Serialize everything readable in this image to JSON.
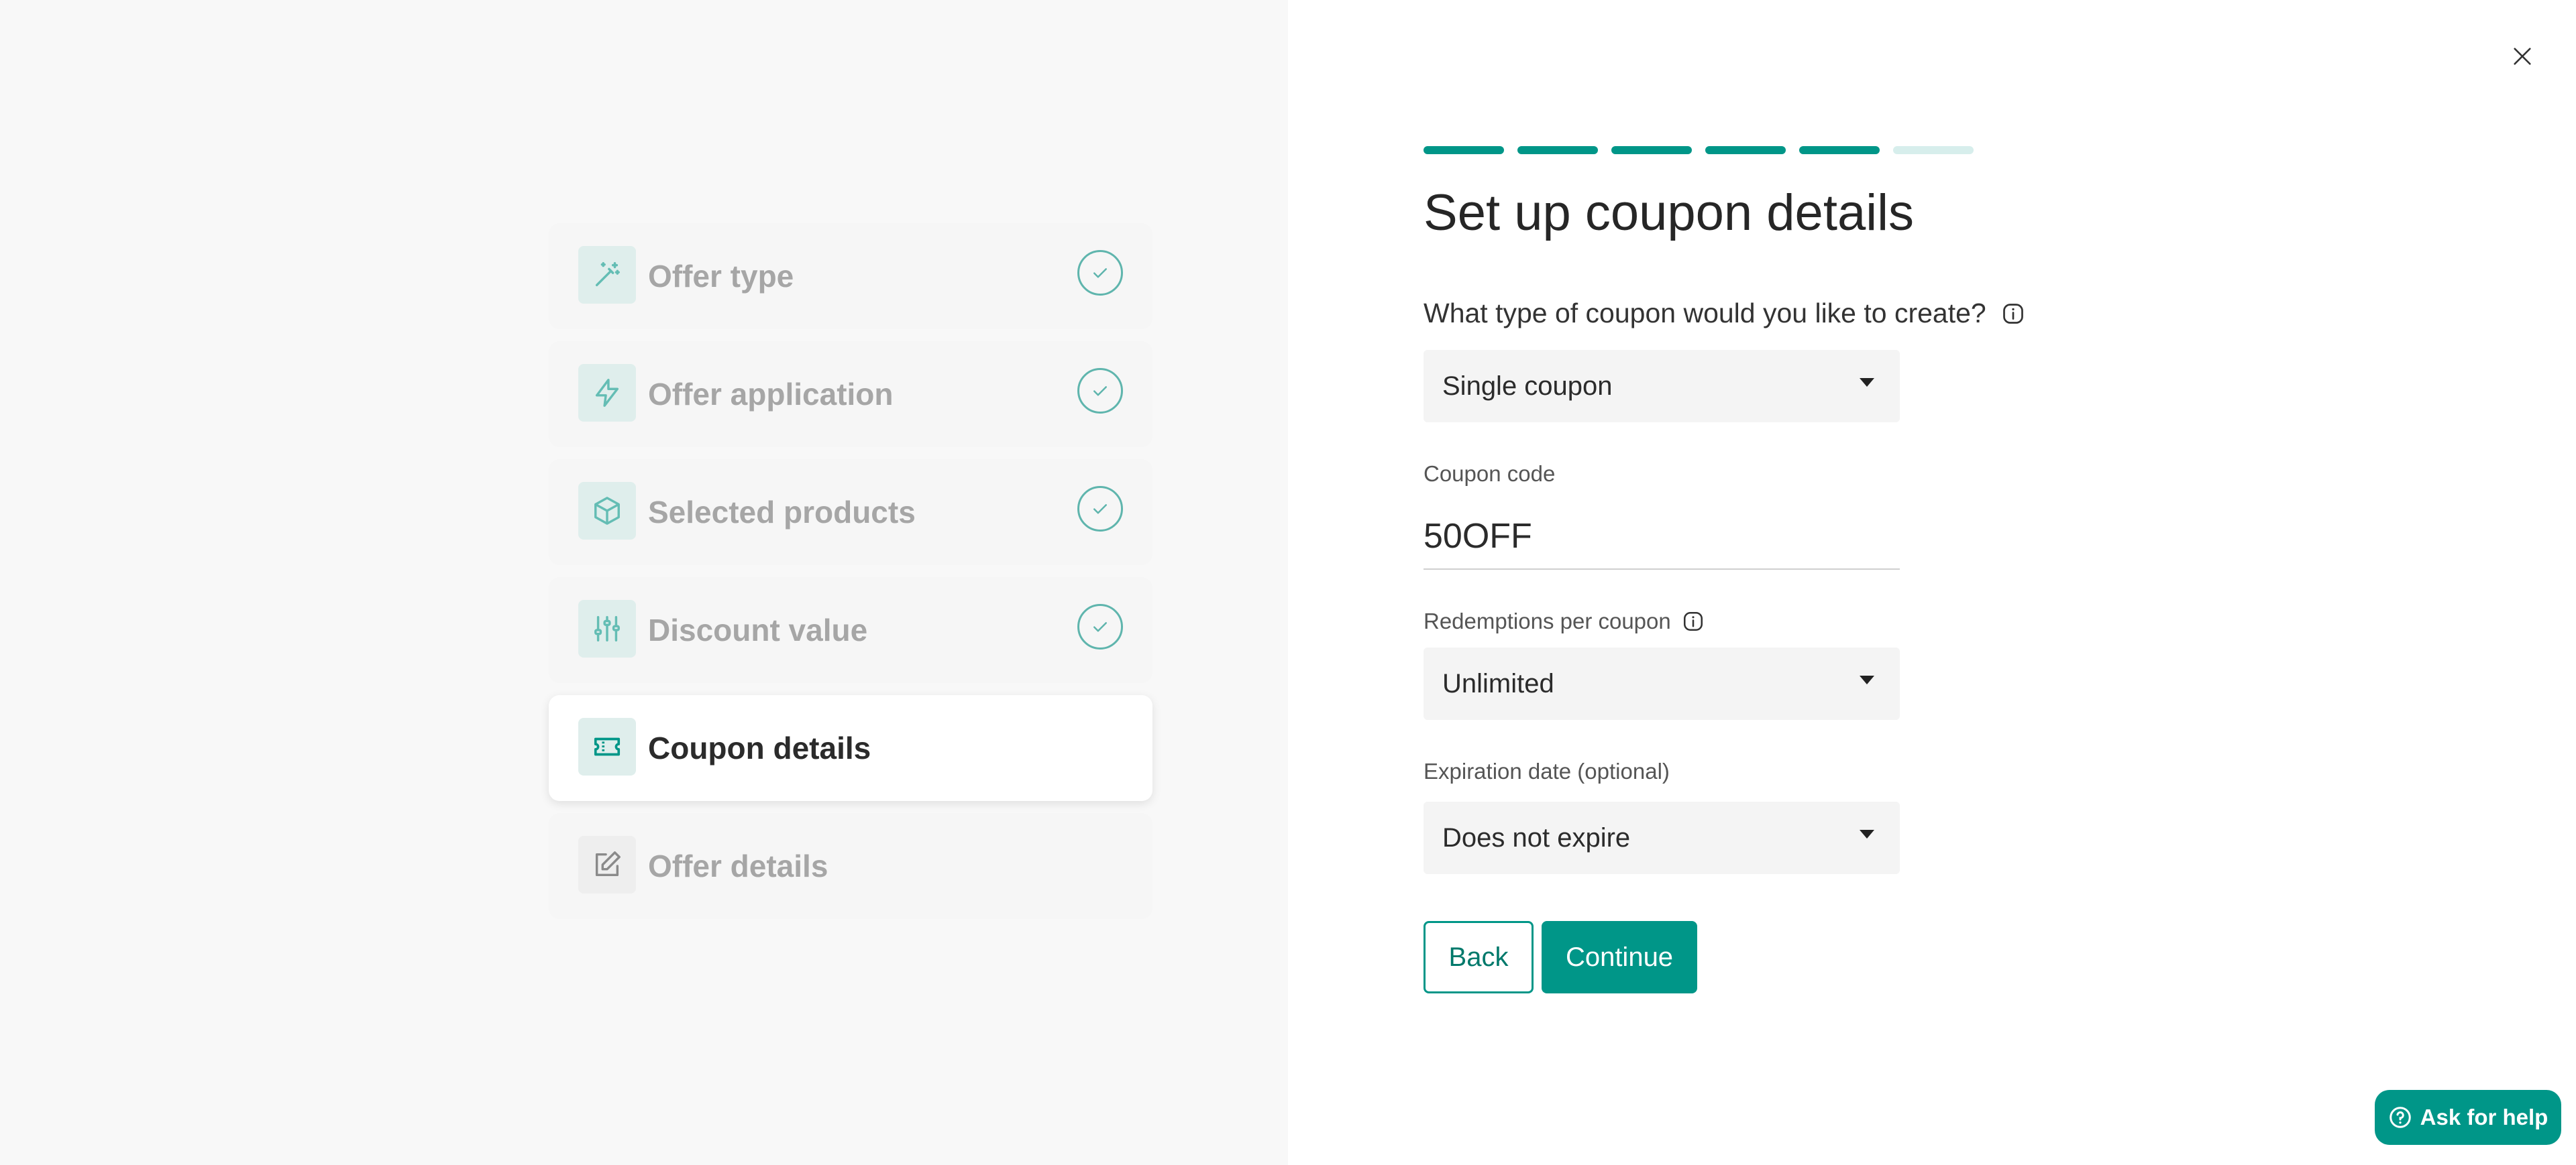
{
  "steps": [
    {
      "label": "Offer type",
      "icon": "magic-wand-icon",
      "state": "done"
    },
    {
      "label": "Offer application",
      "icon": "lightning-bolt-icon",
      "state": "done"
    },
    {
      "label": "Selected products",
      "icon": "box-icon",
      "state": "done"
    },
    {
      "label": "Discount value",
      "icon": "sliders-icon",
      "state": "done"
    },
    {
      "label": "Coupon details",
      "icon": "ticket-icon",
      "state": "active"
    },
    {
      "label": "Offer details",
      "icon": "edit-icon",
      "state": "upcoming"
    }
  ],
  "progress": {
    "completed": 5,
    "total": 6
  },
  "form": {
    "title": "Set up coupon details",
    "coupon_type_question": "What type of coupon would you like to create?",
    "coupon_type_value": "Single coupon",
    "coupon_code_label": "Coupon code",
    "coupon_code_value": "50OFF",
    "redemptions_label": "Redemptions per coupon",
    "redemptions_value": "Unlimited",
    "expiration_label": "Expiration date (optional)",
    "expiration_value": "Does not expire"
  },
  "buttons": {
    "back": "Back",
    "continue": "Continue"
  },
  "help": {
    "label": "Ask for help"
  },
  "colors": {
    "accent": "#009688",
    "accent_light": "#d7eeec",
    "panel_bg": "#f8f8f8"
  }
}
